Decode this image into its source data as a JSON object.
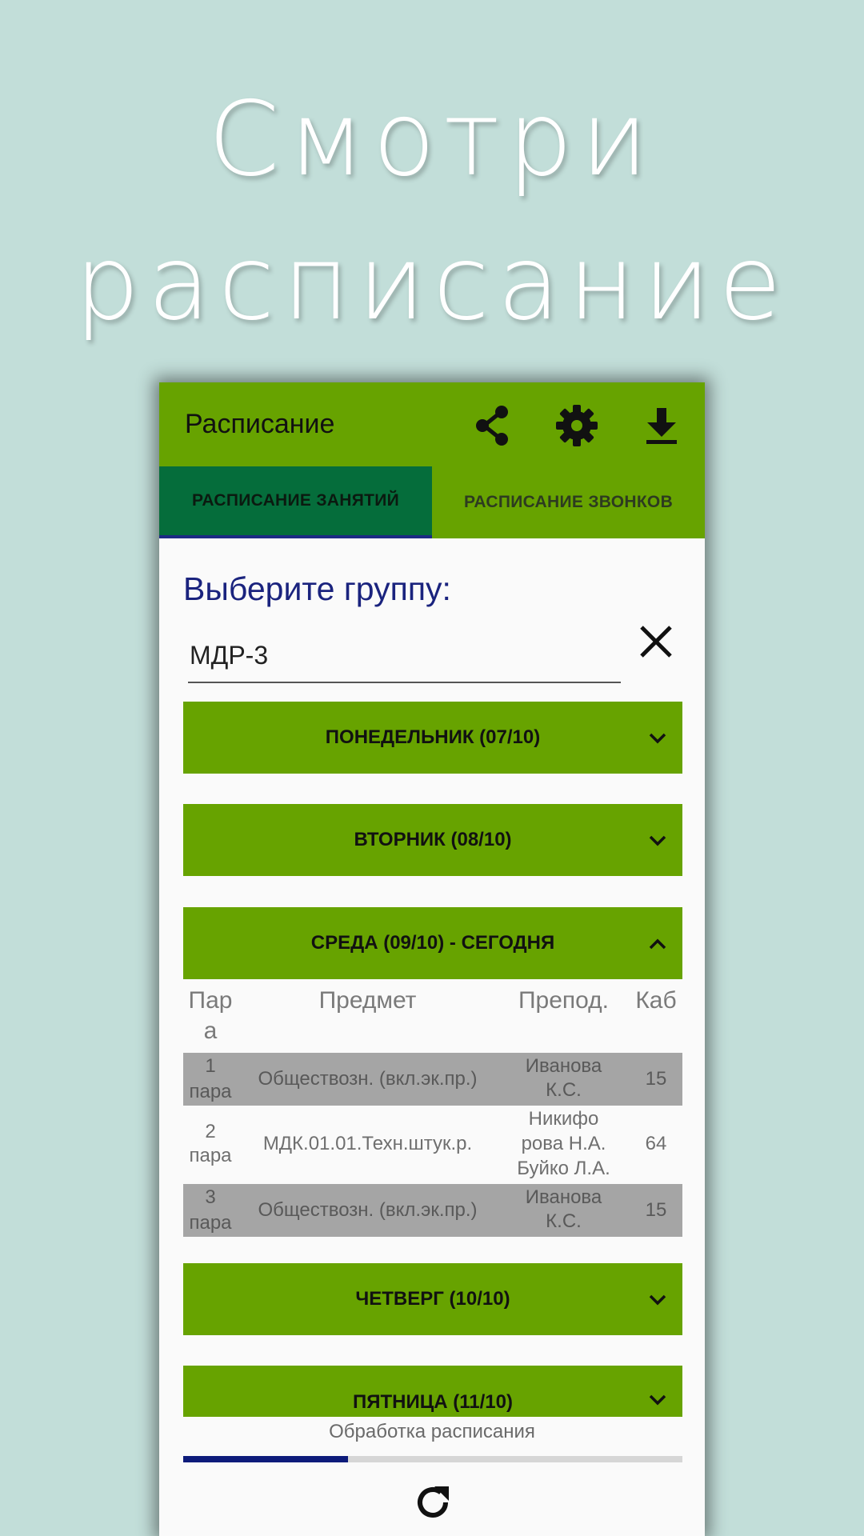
{
  "promo": {
    "line1": "Смотри",
    "line2": "расписание"
  },
  "appbar": {
    "title": "Расписание",
    "icons": [
      "share-icon",
      "gear-icon",
      "download-icon"
    ],
    "color": "#67a300"
  },
  "tabs": [
    {
      "label": "РАСПИСАНИЕ ЗАНЯТИЙ",
      "active": true
    },
    {
      "label": "РАСПИСАНИЕ ЗВОНКОВ",
      "active": false
    }
  ],
  "group": {
    "label": "Выберите группу:",
    "value": "МДР-3"
  },
  "days": [
    {
      "label": "ПОНЕДЕЛЬНИК (07/10)",
      "expanded": false
    },
    {
      "label": "ВТОРНИК (08/10)",
      "expanded": false
    },
    {
      "label": "СРЕДА (09/10) - СЕГОДНЯ",
      "expanded": true
    },
    {
      "label": "ЧЕТВЕРГ (10/10)",
      "expanded": false
    },
    {
      "label": "ПЯТНИЦА (11/10)",
      "expanded": false
    }
  ],
  "schedule": {
    "columns": [
      "Пар",
      "а",
      "Предмет",
      "Препод.",
      "Каб"
    ],
    "rows": [
      {
        "num1": "1",
        "num2": "пара",
        "subject": "Обществозн. (вкл.эк.пр.)",
        "teacher1": "Иванова",
        "teacher2": "К.С.",
        "teacher3": "",
        "room": "15"
      },
      {
        "num1": "2",
        "num2": "пара",
        "subject": "МДК.01.01.Техн.штук.р.",
        "teacher1": "Никифо",
        "teacher2": "рова Н.А.",
        "teacher3": "Буйко Л.А.",
        "room": "64"
      },
      {
        "num1": "3",
        "num2": "пара",
        "subject": "Обществозн. (вкл.эк.пр.)",
        "teacher1": "Иванова",
        "teacher2": "К.С.",
        "teacher3": "",
        "room": "15"
      }
    ]
  },
  "status": {
    "text": "Обработка расписания",
    "progress": 0.33
  }
}
